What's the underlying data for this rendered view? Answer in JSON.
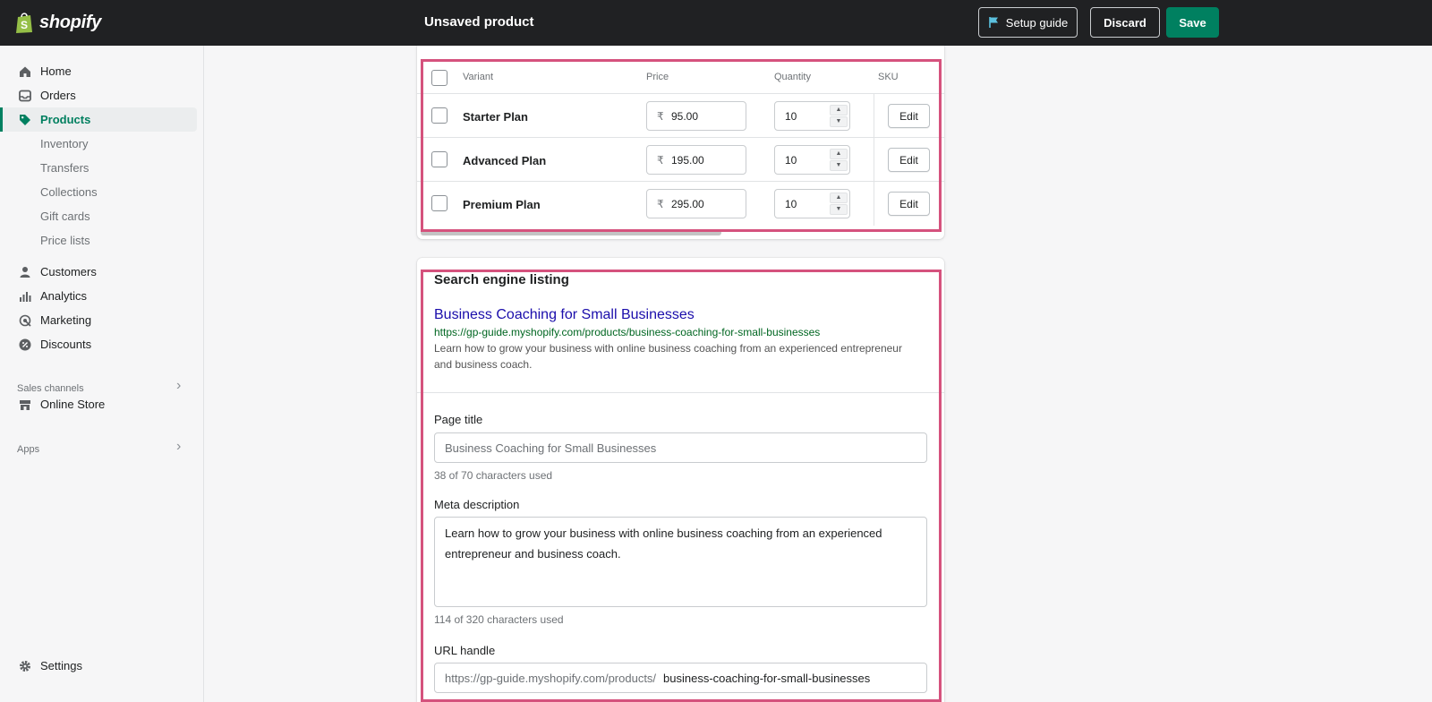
{
  "app": {
    "brand": "shopify",
    "page_title": "Unsaved product"
  },
  "topbar": {
    "setup_guide": "Setup guide",
    "discard": "Discard",
    "save": "Save"
  },
  "sidebar": {
    "items": [
      {
        "label": "Home",
        "icon": "home-icon"
      },
      {
        "label": "Orders",
        "icon": "orders-icon"
      },
      {
        "label": "Products",
        "icon": "tag-icon",
        "active": true
      },
      {
        "label": "Inventory"
      },
      {
        "label": "Transfers"
      },
      {
        "label": "Collections"
      },
      {
        "label": "Gift cards"
      },
      {
        "label": "Price lists"
      },
      {
        "label": "Customers",
        "icon": "person-icon"
      },
      {
        "label": "Analytics",
        "icon": "bar-chart-icon"
      },
      {
        "label": "Marketing",
        "icon": "target-icon"
      },
      {
        "label": "Discounts",
        "icon": "discount-icon"
      }
    ],
    "sales_channels": "Sales channels",
    "online_store": "Online Store",
    "apps": "Apps",
    "settings": "Settings"
  },
  "variants": {
    "headers": {
      "variant": "Variant",
      "price": "Price",
      "quantity": "Quantity",
      "sku": "SKU"
    },
    "currency": "₹",
    "edit_label": "Edit",
    "rows": [
      {
        "name": "Starter Plan",
        "price": "95.00",
        "quantity": "10"
      },
      {
        "name": "Advanced Plan",
        "price": "195.00",
        "quantity": "10"
      },
      {
        "name": "Premium Plan",
        "price": "295.00",
        "quantity": "10"
      }
    ]
  },
  "seo": {
    "title": "Search engine listing",
    "preview_title": "Business Coaching for Small Businesses",
    "preview_url": "https://gp-guide.myshopify.com/products/business-coaching-for-small-businesses",
    "preview_desc": "Learn how to grow your business with online business coaching from an experienced entrepreneur and business coach.",
    "page_title_label": "Page title",
    "page_title_value": "Business Coaching for Small Businesses",
    "page_title_count": "38 of 70 characters used",
    "meta_label": "Meta description",
    "meta_value": "Learn how to grow your business with online business coaching from an experienced entrepreneur and business coach.",
    "meta_count": "114 of 320 characters used",
    "url_label": "URL handle",
    "url_prefix": "https://gp-guide.myshopify.com/products/",
    "url_handle": "business-coaching-for-small-businesses"
  },
  "colors": {
    "topbar": "#202123",
    "accent": "#008060",
    "highlight": "#d5527d",
    "link": "#1a0dab",
    "url_green": "#006621"
  }
}
